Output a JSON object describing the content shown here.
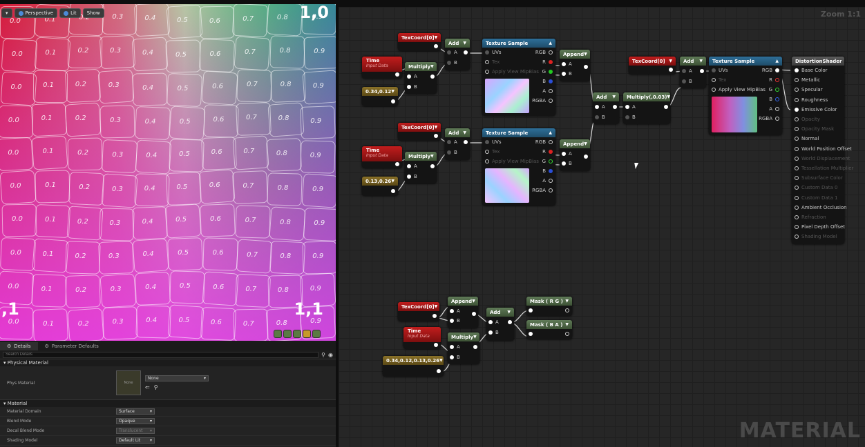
{
  "viewport": {
    "toolbar": {
      "perspective": "Perspective",
      "lit": "Lit",
      "show": "Show"
    },
    "corners": {
      "top_right": "1,0",
      "bottom_left": ",1",
      "bottom_right": "1,1"
    },
    "grid_values": [
      "0.0",
      "0.1",
      "0.2",
      "0.3",
      "0.4",
      "0.5",
      "0.6",
      "0.7",
      "0.8",
      "0.9"
    ]
  },
  "details": {
    "tabs": [
      "Details",
      "Parameter Defaults"
    ],
    "search_placeholder": "Search Details",
    "sections": {
      "physical": "Physical Material",
      "material": "Material"
    },
    "phys_material": {
      "label": "Phys Material",
      "value": "None",
      "thumb": "None"
    },
    "rows": [
      {
        "label": "Material Domain",
        "value": "Surface"
      },
      {
        "label": "Blend Mode",
        "value": "Opaque"
      },
      {
        "label": "Decal Blend Mode",
        "value": "Translucent"
      },
      {
        "label": "Shading Model",
        "value": "Default Lit"
      }
    ]
  },
  "graph": {
    "zoom": "Zoom 1:1",
    "watermark": "MATERIAL",
    "nodes": {
      "texcoord_1": "TexCoord[0]",
      "add_1": "Add",
      "time_1": "Time",
      "time_1_sub": "Input Data",
      "multiply_1": "Multiply",
      "const_1": "0.34,0.12",
      "texsample_1": "Texture Sample",
      "append_1": "Append",
      "texcoord_2": "TexCoord[0]",
      "add_2": "Add",
      "time_2": "Time",
      "time_2_sub": "Input Data",
      "multiply_2": "Multiply",
      "const_2": "0.13,0.26",
      "texsample_2": "Texture Sample",
      "append_2": "Append",
      "add_3": "Add",
      "multiply_3": "Multiply(,0.03)",
      "texcoord_3": "TexCoord[0]",
      "add_4": "Add",
      "texsample_3": "Texture Sample",
      "result": "DistortionShader",
      "texcoord_4": "TexCoord[0]",
      "append_3": "Append",
      "add_5": "Add",
      "mask_rg": "Mask ( R G )",
      "mask_ba": "Mask ( B A )",
      "time_3": "Time",
      "time_3_sub": "Input Data",
      "multiply_4": "Multiply",
      "const_3": "0.34,0.12,0.13,0.26"
    },
    "texsample_pins_in": [
      "UVs",
      "Tex",
      "Apply View MipBias"
    ],
    "texsample_pins_out": [
      "RGB",
      "R",
      "G",
      "B",
      "A",
      "RGBA"
    ],
    "ab_pins": [
      "A",
      "B"
    ],
    "result_pins": [
      {
        "label": "Base Color",
        "active": true
      },
      {
        "label": "Metallic",
        "active": true
      },
      {
        "label": "Specular",
        "active": true
      },
      {
        "label": "Roughness",
        "active": true
      },
      {
        "label": "Emissive Color",
        "active": true
      },
      {
        "label": "Opacity",
        "active": false
      },
      {
        "label": "Opacity Mask",
        "active": false
      },
      {
        "label": "Normal",
        "active": true
      },
      {
        "label": "World Position Offset",
        "active": true
      },
      {
        "label": "World Displacement",
        "active": false
      },
      {
        "label": "Tessellation Multiplier",
        "active": false
      },
      {
        "label": "Subsurface Color",
        "active": false
      },
      {
        "label": "Custom Data 0",
        "active": false
      },
      {
        "label": "Custom Data 1",
        "active": false
      },
      {
        "label": "Ambient Occlusion",
        "active": true
      },
      {
        "label": "Refraction",
        "active": false
      },
      {
        "label": "Pixel Depth Offset",
        "active": true
      },
      {
        "label": "Shading Model",
        "active": false
      }
    ]
  }
}
